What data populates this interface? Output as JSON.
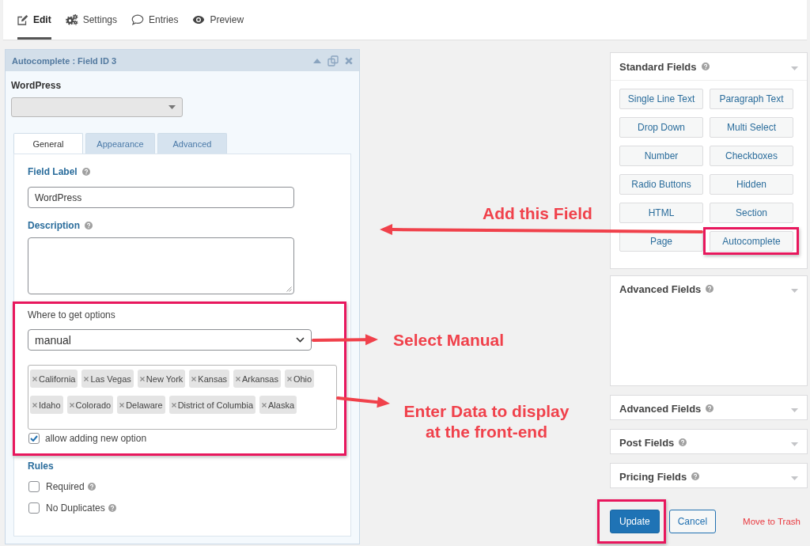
{
  "top_tabs": [
    {
      "label": "Edit",
      "selected": true
    },
    {
      "label": "Settings",
      "selected": false
    },
    {
      "label": "Entries",
      "selected": false
    },
    {
      "label": "Preview",
      "selected": false
    }
  ],
  "field_panel": {
    "title": "Autocomplete : Field ID 3",
    "preview": {
      "label": "WordPress",
      "disabled": true
    },
    "tabs": [
      {
        "label": "General",
        "selected": true
      },
      {
        "label": "Appearance",
        "selected": false
      },
      {
        "label": "Advanced",
        "selected": false
      }
    ],
    "field_label": {
      "label": "Field Label",
      "value": "WordPress"
    },
    "description": {
      "label": "Description"
    },
    "options": {
      "highlighted": true,
      "label": "Where to get options",
      "source": "manual",
      "tags": [
        "California",
        "Las Vegas",
        "New York",
        "Kansas",
        "Arkansas",
        "Ohio",
        "Idaho",
        "Colorado",
        "Delaware",
        "District of Columbia",
        "Alaska"
      ],
      "allow_new": {
        "label": "allow adding new option",
        "checked": true
      }
    },
    "rules": {
      "title": "Rules",
      "items": [
        {
          "label": "Required",
          "checked": false
        },
        {
          "label": "No Duplicates",
          "checked": false
        }
      ]
    }
  },
  "standard_fields": {
    "title": "Standard Fields",
    "buttons": [
      {
        "label": "Single Line Text",
        "highlighted": false
      },
      {
        "label": "Paragraph Text",
        "highlighted": false
      },
      {
        "label": "Drop Down",
        "highlighted": false
      },
      {
        "label": "Multi Select",
        "highlighted": false
      },
      {
        "label": "Number",
        "highlighted": false
      },
      {
        "label": "Checkboxes",
        "highlighted": false
      },
      {
        "label": "Radio Buttons",
        "highlighted": false
      },
      {
        "label": "Hidden",
        "highlighted": false
      },
      {
        "label": "HTML",
        "highlighted": false
      },
      {
        "label": "Section",
        "highlighted": false
      },
      {
        "label": "Page",
        "highlighted": false
      },
      {
        "label": "Autocomplete",
        "highlighted": true
      }
    ]
  },
  "field_groups": [
    {
      "title": "Advanced Fields",
      "expanded": true
    },
    {
      "title": "Advanced Fields",
      "expanded": false
    },
    {
      "title": "Post Fields",
      "expanded": false
    },
    {
      "title": "Pricing Fields",
      "expanded": false
    }
  ],
  "actions": {
    "update": {
      "label": "Update",
      "highlighted": true
    },
    "cancel": "Cancel",
    "trash": "Move to Trash"
  },
  "annotations": [
    {
      "text": "Add this Field"
    },
    {
      "text": "Select Manual"
    },
    {
      "text": "Enter Data to display\nat the front-end"
    }
  ]
}
